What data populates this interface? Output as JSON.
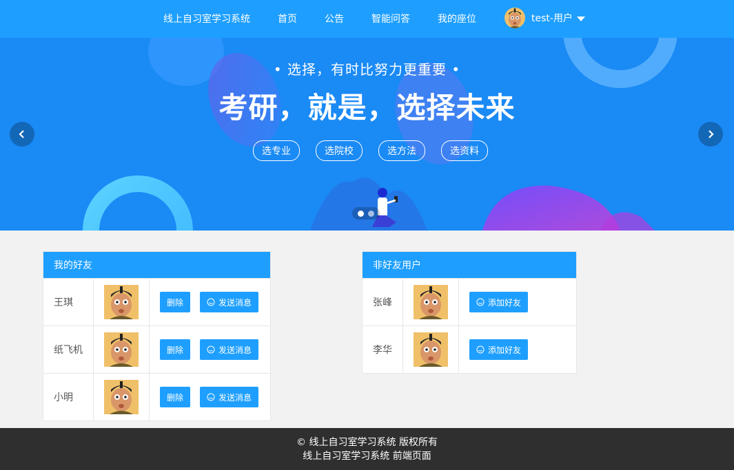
{
  "nav": {
    "brand": "线上自习室学习系统",
    "items": [
      "首页",
      "公告",
      "智能问答",
      "我的座位"
    ],
    "user_name": "test-用户"
  },
  "banner": {
    "subtitle": "• 选择，有时比努力更重要 •",
    "title": "考研，就是，选择未来",
    "tags": [
      "选专业",
      "选院校",
      "选方法",
      "选资料"
    ],
    "slide_count": 2,
    "active_slide": 1
  },
  "friends": {
    "title": "我的好友",
    "delete_label": "删除",
    "message_label": "发送消息",
    "rows": [
      {
        "name": "王琪"
      },
      {
        "name": "纸飞机"
      },
      {
        "name": "小明"
      }
    ]
  },
  "non_friends": {
    "title": "非好友用户",
    "add_label": "添加好友",
    "rows": [
      {
        "name": "张峰"
      },
      {
        "name": "李华"
      }
    ]
  },
  "footer": {
    "line1": "© 线上自习室学习系统 版权所有",
    "line2": "线上自习室学习系统 前端页面"
  },
  "colors": {
    "primary": "#1e9fff",
    "banner_bg": "#1a8af5",
    "footer_bg": "#2f2f2f",
    "page_bg": "#f2f2f2"
  }
}
